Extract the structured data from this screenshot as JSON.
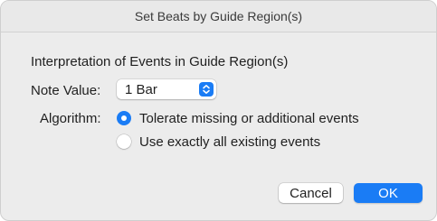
{
  "window": {
    "title": "Set Beats by Guide Region(s)"
  },
  "content": {
    "section_title": "Interpretation of Events in Guide Region(s)",
    "note_value": {
      "label": "Note Value:",
      "selected": "1 Bar",
      "icon": "up-down-chevron-icon"
    },
    "algorithm": {
      "label": "Algorithm:",
      "options": [
        {
          "label": "Tolerate missing or additional events",
          "selected": true
        },
        {
          "label": "Use exactly all existing events",
          "selected": false
        }
      ]
    }
  },
  "buttons": {
    "cancel_label": "Cancel",
    "ok_label": "OK"
  },
  "colors": {
    "accent": "#1a7cf5",
    "background": "#ececec"
  }
}
